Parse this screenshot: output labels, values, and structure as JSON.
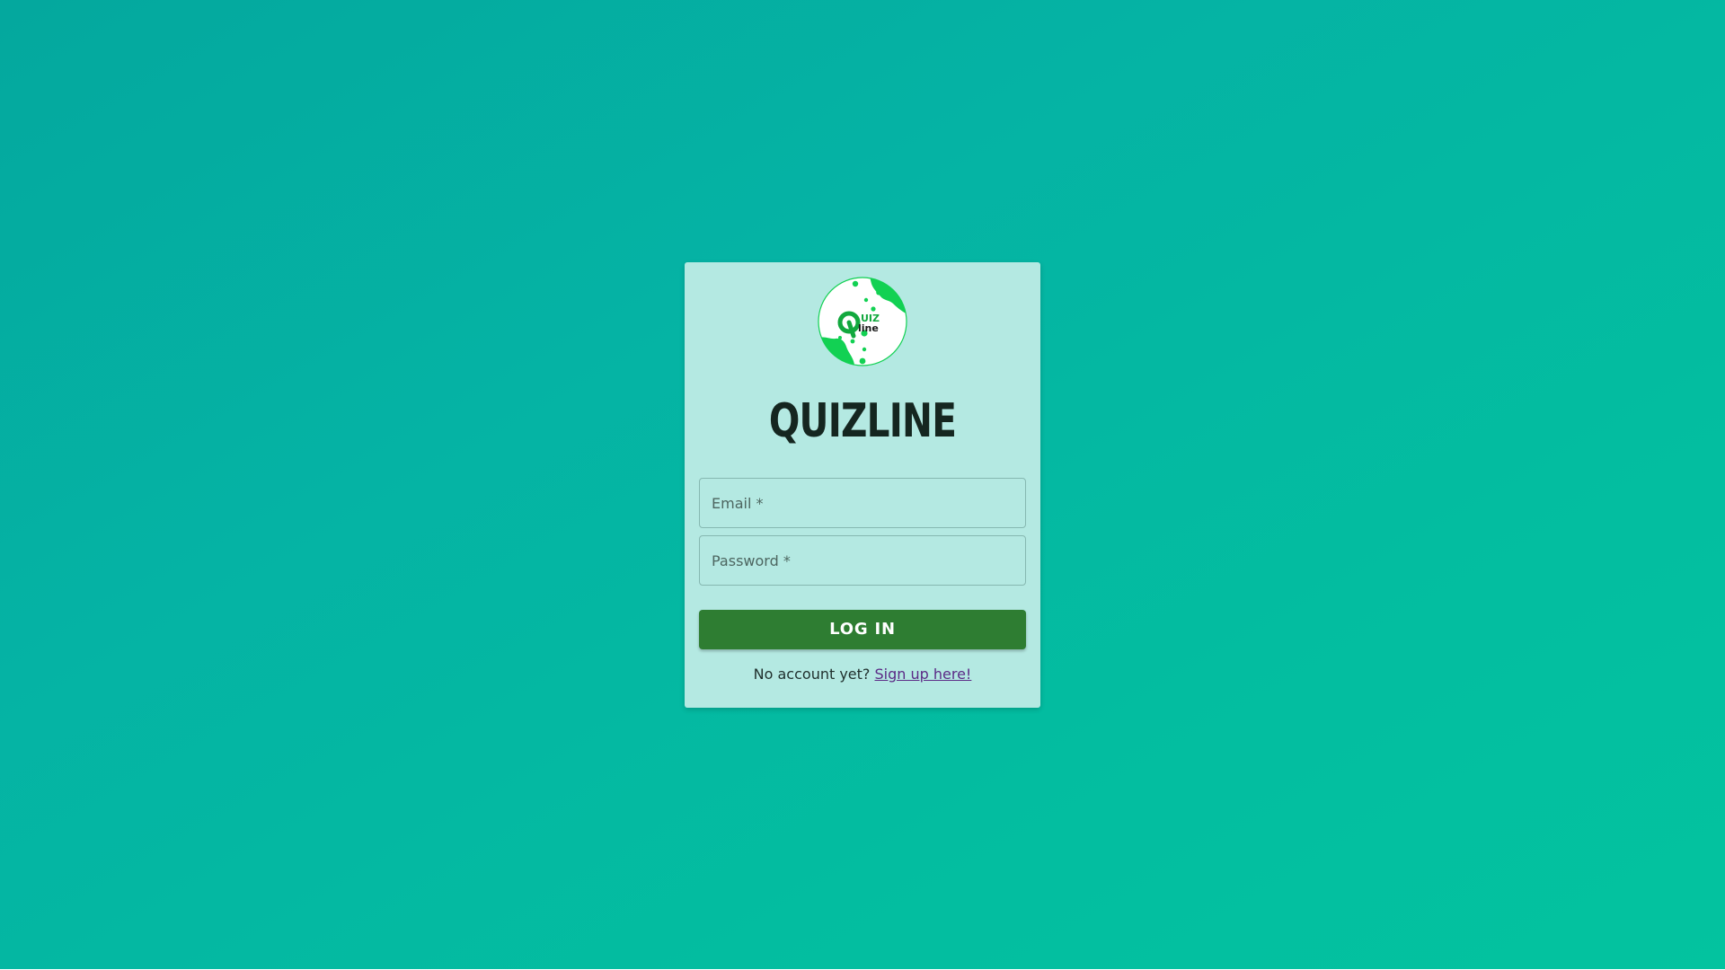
{
  "brand": {
    "title": "QUIZLINE",
    "logo_text_top": "UIZ",
    "logo_text_bottom": "line",
    "logo_icon": "quizline-logo-icon"
  },
  "login_form": {
    "email_label": "Email *",
    "password_label": "Password *",
    "submit_label": "LOG IN",
    "signup_prompt": "No account yet?",
    "signup_link": "Sign up here!"
  },
  "colors": {
    "background_start": "#04a89e",
    "background_end": "#03c39f",
    "card": "#b4e9e2",
    "button": "#2e7d32",
    "link": "#5b2a86",
    "logo_green": "#12d153"
  }
}
